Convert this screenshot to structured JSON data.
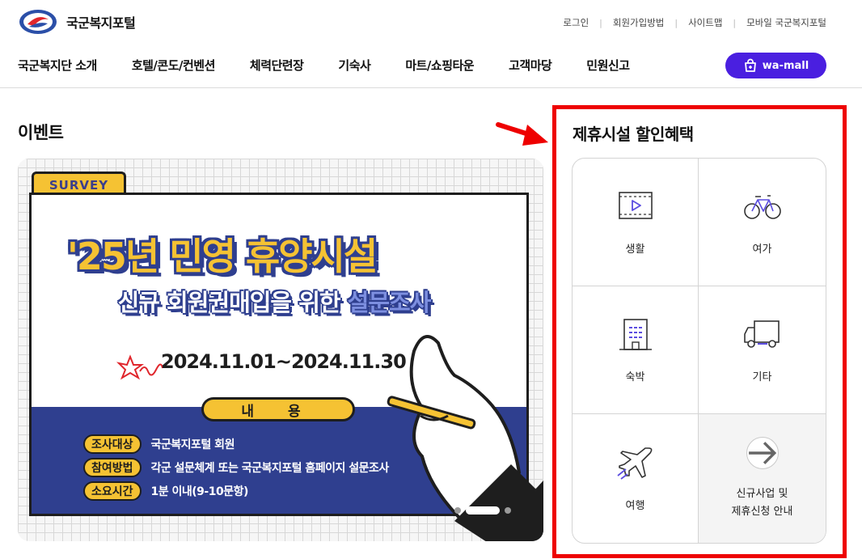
{
  "header": {
    "logo_text": "국군복지포털",
    "util_links": [
      "로그인",
      "회원가입방법",
      "사이트맵",
      "모바일 국군복지포털"
    ],
    "nav": [
      "국군복지단 소개",
      "호텔/콘도/컨벤션",
      "체력단련장",
      "기숙사",
      "마트/쇼핑타운",
      "고객마당",
      "민원신고"
    ],
    "wamall_label": "wa-mall"
  },
  "events": {
    "title": "이벤트",
    "banner": {
      "tag": "SURVEY",
      "title_line1": "'25년 민영 휴양시설",
      "title_line2_prefix": "신규 회원권매입을 위한 ",
      "title_line2_highlight": "설문조사",
      "date": "2024.11.01~2024.11.30",
      "content_label": "내 용",
      "rows": [
        {
          "tag": "조사대상",
          "value": "국군복지포털 회원"
        },
        {
          "tag": "참여방법",
          "value": "각군 설문체계 또는 국군복지포털 홈페이지 설문조사"
        },
        {
          "tag": "소요시간",
          "value": "1분 이내(9-10문항)"
        }
      ]
    }
  },
  "partners": {
    "title": "제휴시설 할인혜택",
    "items": [
      {
        "label": "생활",
        "icon": "video-icon"
      },
      {
        "label": "여가",
        "icon": "bicycle-icon"
      },
      {
        "label": "숙박",
        "icon": "building-icon"
      },
      {
        "label": "기타",
        "icon": "truck-icon"
      },
      {
        "label": "여행",
        "icon": "airplane-icon"
      },
      {
        "label_line1": "신규사업 및",
        "label_line2": "제휴신청 안내",
        "icon": "arrow-right-icon"
      }
    ]
  },
  "colors": {
    "accent": "#4a1fe0",
    "highlight": "#ee0000",
    "banner_yellow": "#f5c233",
    "banner_navy": "#2f3f8f"
  }
}
